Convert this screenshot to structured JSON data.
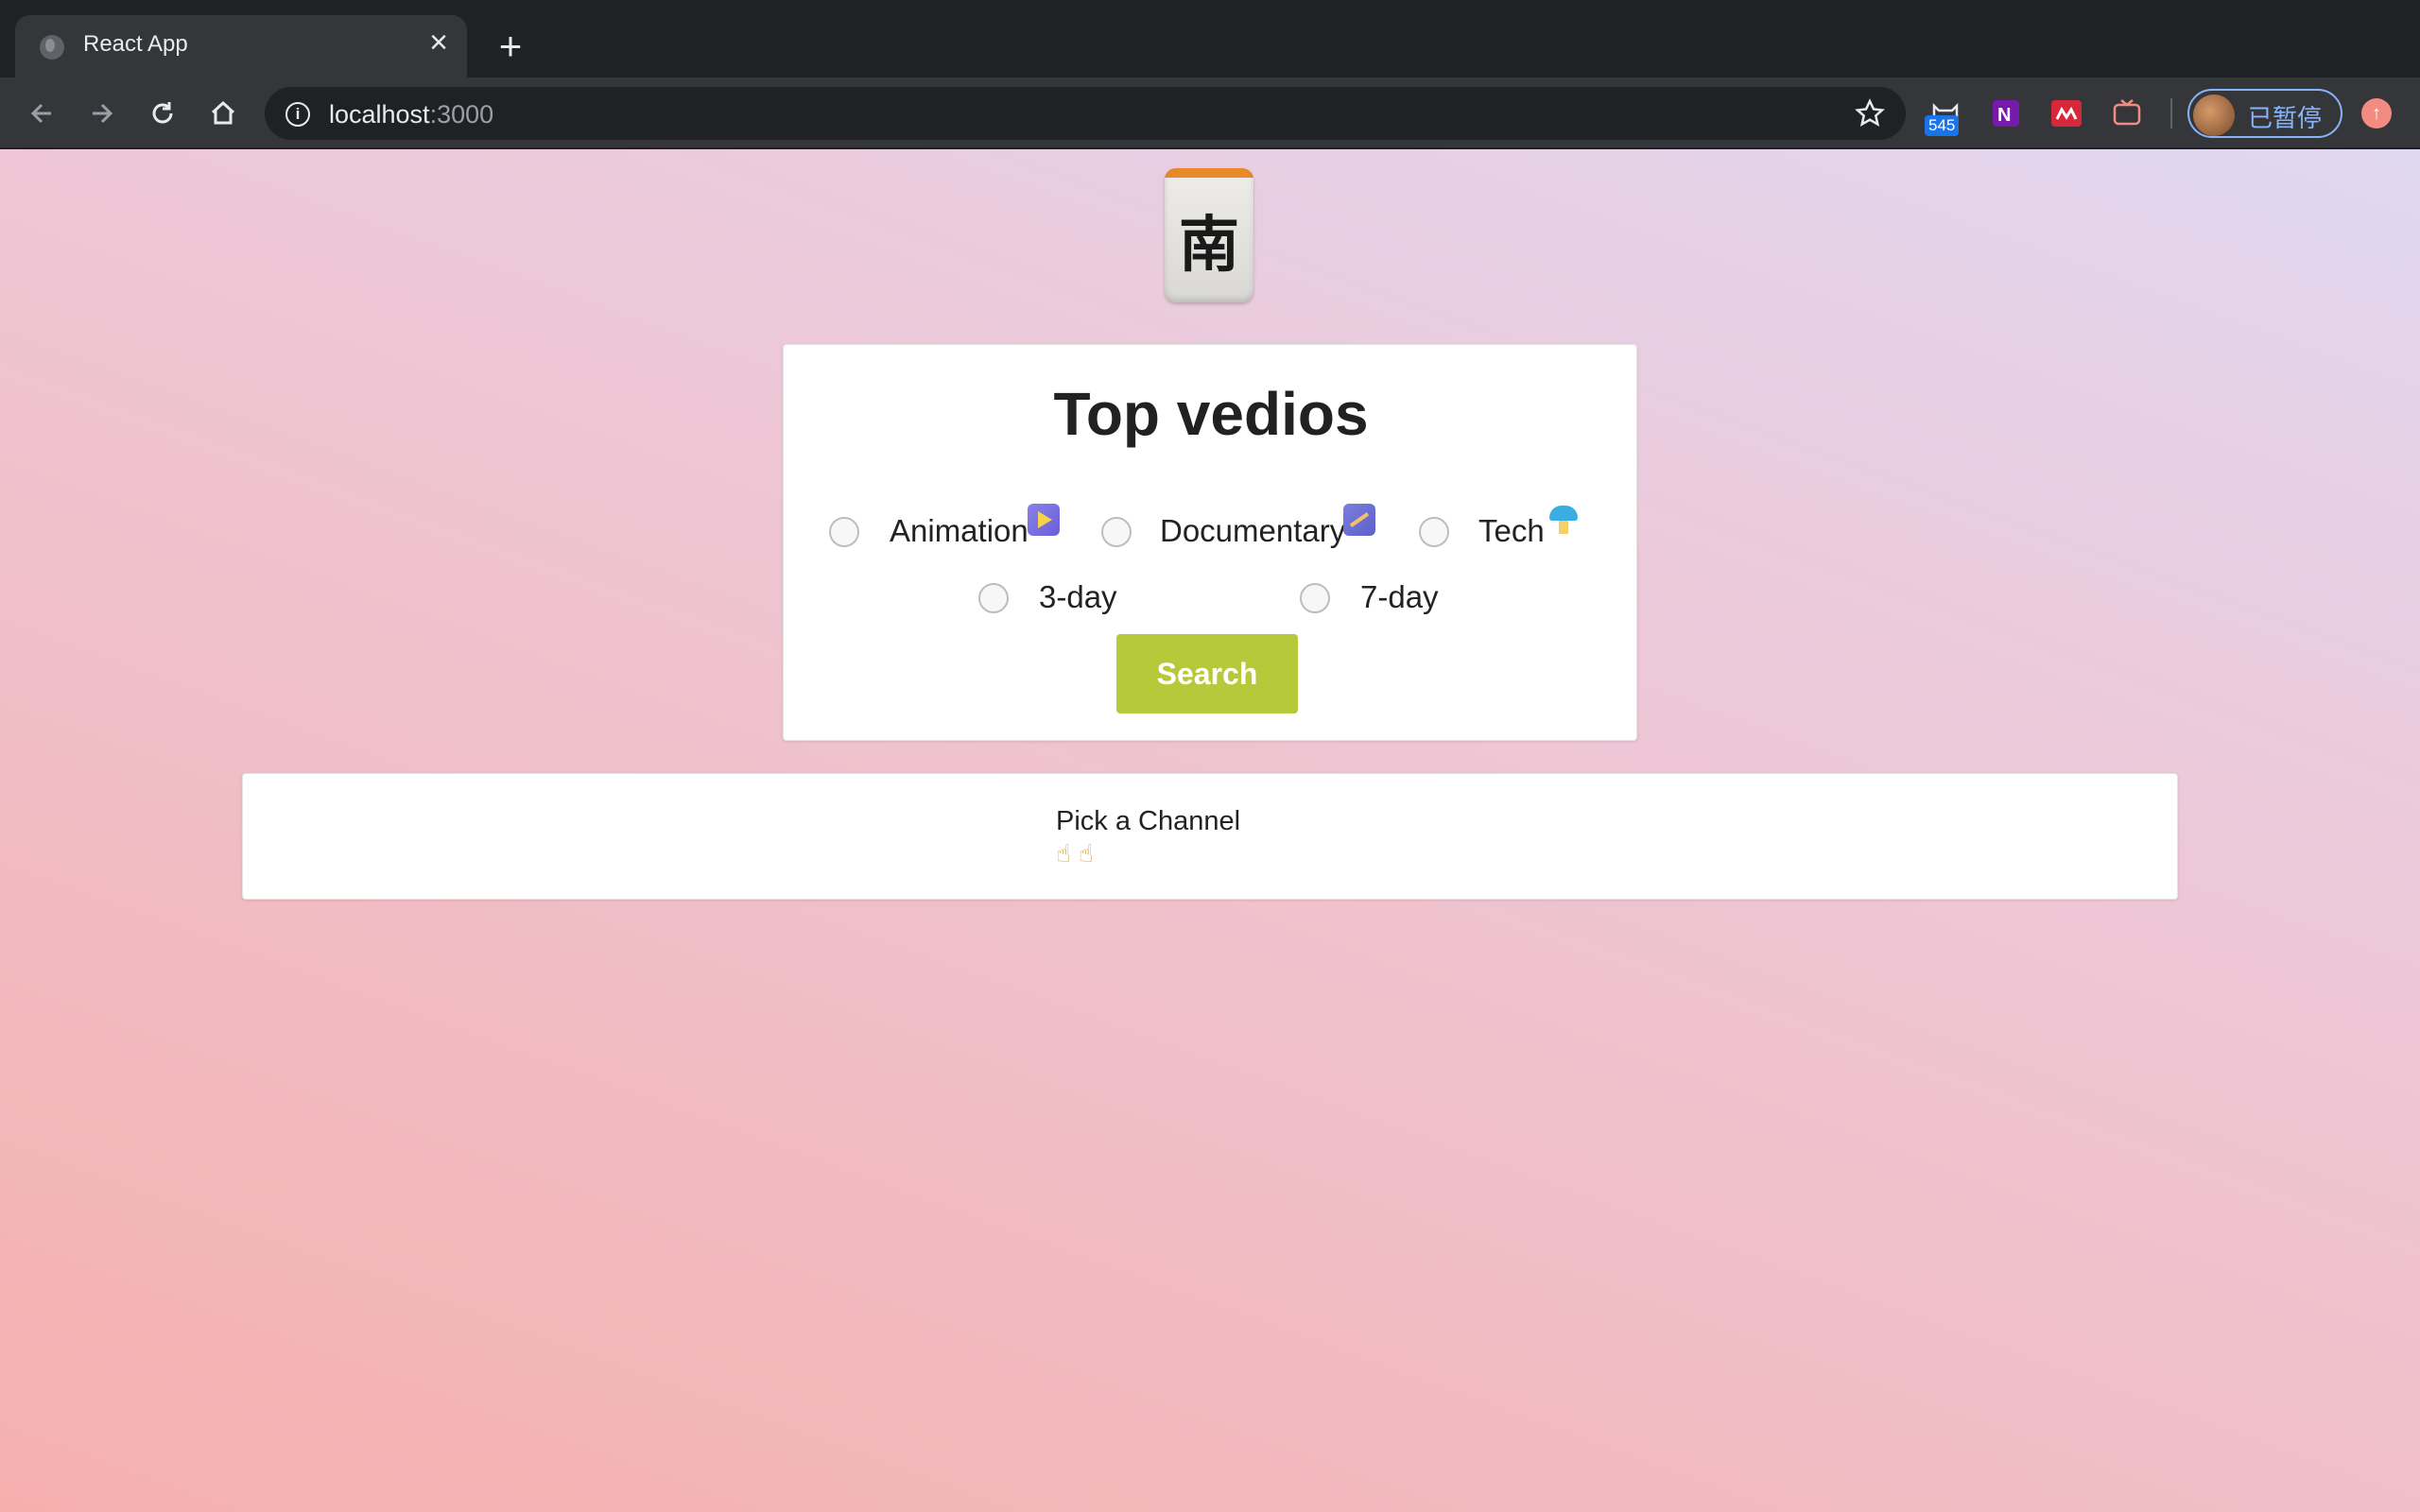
{
  "browser": {
    "tab_title": "React App",
    "url_host": "localhost",
    "url_port": ":3000",
    "extension_badge": "545",
    "profile_label": "已暂停"
  },
  "page": {
    "logo_glyph": "南",
    "title": "Top vedios",
    "channels": [
      {
        "label": "Animation",
        "icon": "play-icon"
      },
      {
        "label": "Documentary",
        "icon": "clapper-icon"
      },
      {
        "label": "Tech",
        "icon": "ufo-icon"
      }
    ],
    "durations": [
      {
        "label": "3-day"
      },
      {
        "label": "7-day"
      }
    ],
    "search_label": "Search",
    "result": {
      "message": "Pick a Channel",
      "emoji": "☝☝"
    }
  },
  "colors": {
    "search_button": "#b5c93a",
    "tab_strip": "#202124",
    "toolbar": "#35363a"
  }
}
